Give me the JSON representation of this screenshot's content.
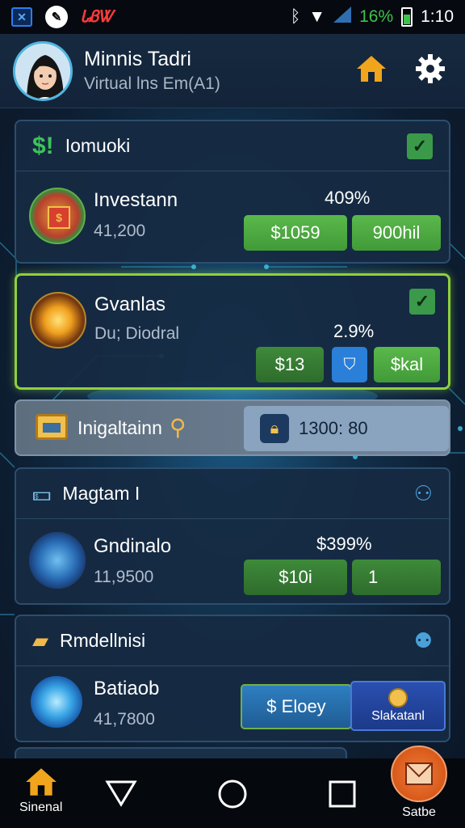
{
  "status_bar": {
    "left_icons": [
      "app-icon",
      "pen-icon",
      "brand-logo"
    ],
    "brand_text": "ᏓᏰᏔ",
    "battery_percent": "16%",
    "time": "1:10"
  },
  "header": {
    "name": "Minnis Tadri",
    "subtitle": "Virtual lns Em(A1)"
  },
  "sections": {
    "s1": {
      "title": "Iomuoki",
      "row": {
        "title": "Investann",
        "sub": "41,200",
        "pct": "409%",
        "btn1": "$1059",
        "btn2": "900hil"
      }
    },
    "s2": {
      "row": {
        "title": "Gvanlas",
        "sub": "Du; Diodral",
        "pct": "2.9%",
        "btn1": "$13",
        "btn3": "$kal"
      }
    },
    "s3": {
      "title": "Inigaltainn",
      "value": "1300: 80"
    },
    "s4": {
      "title": "Magtam I",
      "row": {
        "title": "Gndinalo",
        "sub": "11,9500",
        "pct": "$399%",
        "btn1": "$10i",
        "btn2": "1"
      }
    },
    "s5": {
      "title": "Rmdellnisi",
      "row": {
        "title": "Batiaob",
        "sub": "41,7800",
        "btn1": "$ Eloey",
        "btn2": "Slakatanl"
      }
    }
  },
  "nav": {
    "left_label": "Sinenal",
    "right_label": "Satbe"
  },
  "colors": {
    "accent_green": "#5ab84b",
    "highlight_border": "#8fd03c",
    "accent_blue": "#2a7fd8"
  }
}
